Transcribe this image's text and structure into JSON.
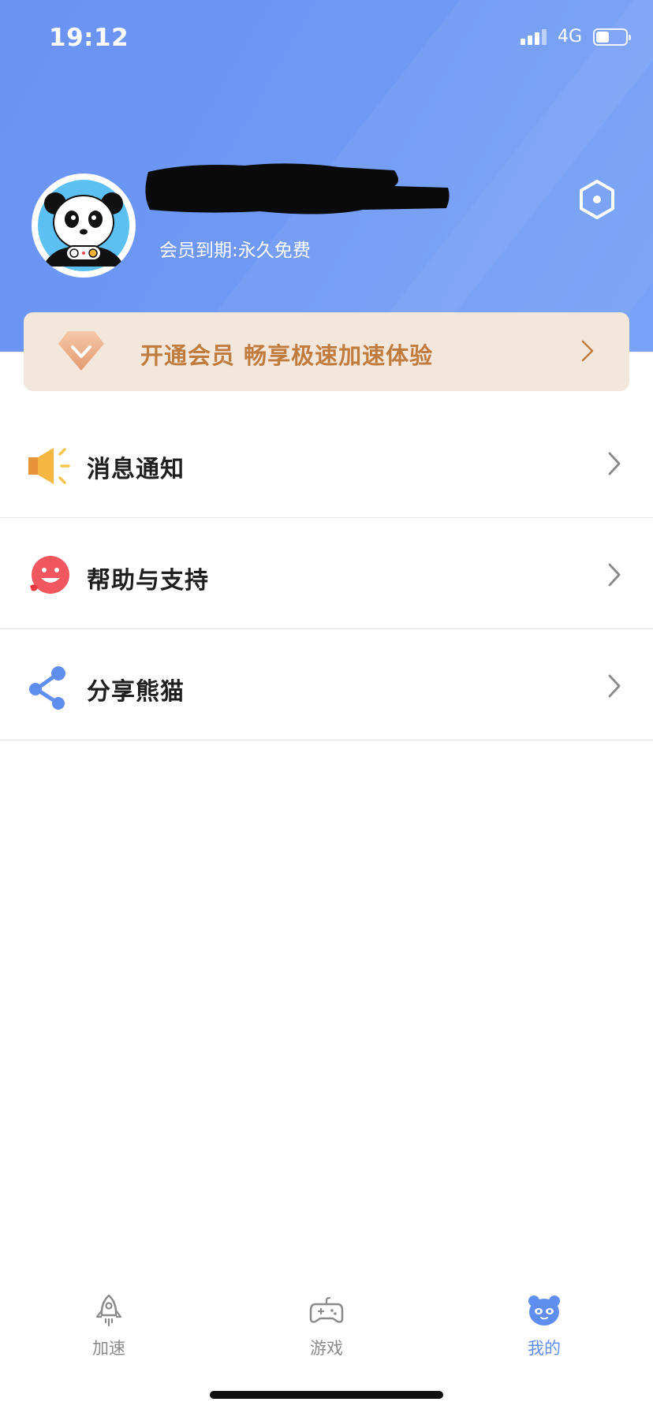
{
  "status_bar": {
    "time": "19:12",
    "network": "4G",
    "battery_level_pct": 45
  },
  "profile": {
    "avatar_icon": "panda-gamer-avatar",
    "member_status": "会员到期:永久免费",
    "settings_icon": "hexagon-settings-icon"
  },
  "vip_banner": {
    "icon": "diamond-icon",
    "text": "开通会员 畅享极速加速体验"
  },
  "menu": {
    "items": [
      {
        "label": "消息通知",
        "icon": "megaphone-icon"
      },
      {
        "label": "帮助与支持",
        "icon": "smiley-face-icon"
      },
      {
        "label": "分享熊猫",
        "icon": "share-icon"
      }
    ]
  },
  "tabbar": {
    "tabs": [
      {
        "label": "加速",
        "icon": "rocket-icon",
        "active": false
      },
      {
        "label": "游戏",
        "icon": "gamepad-icon",
        "active": false
      },
      {
        "label": "我的",
        "icon": "panda-face-icon",
        "active": true
      }
    ]
  },
  "colors": {
    "header_blue": "#6f9af4",
    "vip_bg": "#f3e6da",
    "vip_text": "#c07c3e",
    "active_tab": "#5f8ef0",
    "inactive_tab": "#8a8a8a"
  }
}
